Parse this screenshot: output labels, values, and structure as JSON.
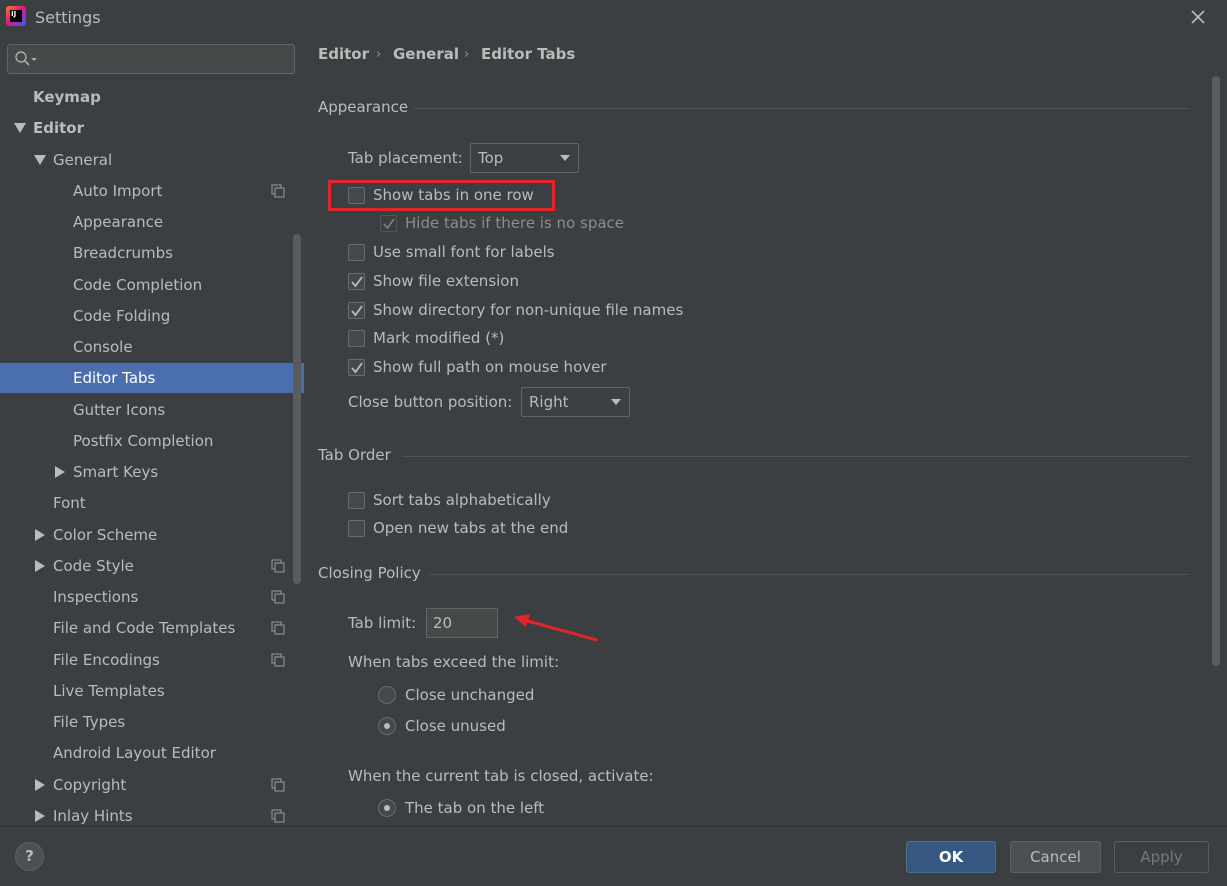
{
  "window": {
    "title": "Settings"
  },
  "search": {
    "placeholder": ""
  },
  "sidebar": {
    "items": [
      {
        "label": "Keymap"
      },
      {
        "label": "Editor"
      },
      {
        "label": "General"
      },
      {
        "label": "Auto Import"
      },
      {
        "label": "Appearance"
      },
      {
        "label": "Breadcrumbs"
      },
      {
        "label": "Code Completion"
      },
      {
        "label": "Code Folding"
      },
      {
        "label": "Console"
      },
      {
        "label": "Editor Tabs"
      },
      {
        "label": "Gutter Icons"
      },
      {
        "label": "Postfix Completion"
      },
      {
        "label": "Smart Keys"
      },
      {
        "label": "Font"
      },
      {
        "label": "Color Scheme"
      },
      {
        "label": "Code Style"
      },
      {
        "label": "Inspections"
      },
      {
        "label": "File and Code Templates"
      },
      {
        "label": "File Encodings"
      },
      {
        "label": "Live Templates"
      },
      {
        "label": "File Types"
      },
      {
        "label": "Android Layout Editor"
      },
      {
        "label": "Copyright"
      },
      {
        "label": "Inlay Hints"
      }
    ]
  },
  "breadcrumb": [
    "Editor",
    "General",
    "Editor Tabs"
  ],
  "appearance": {
    "title": "Appearance",
    "tab_placement_label": "Tab placement:",
    "tab_placement_value": "Top",
    "show_tabs_one_row": "Show tabs in one row",
    "hide_tabs_no_space": "Hide tabs if there is no space",
    "small_font": "Use small font for labels",
    "show_extension": "Show file extension",
    "show_directory": "Show directory for non-unique file names",
    "mark_modified": "Mark modified (*)",
    "full_path_hover": "Show full path on mouse hover",
    "close_button_label": "Close button position:",
    "close_button_value": "Right"
  },
  "tab_order": {
    "title": "Tab Order",
    "sort_alpha": "Sort tabs alphabetically",
    "open_at_end": "Open new tabs at the end"
  },
  "closing_policy": {
    "title": "Closing Policy",
    "tab_limit_label": "Tab limit:",
    "tab_limit_value": "20",
    "exceed_label": "When tabs exceed the limit:",
    "close_unchanged": "Close unchanged",
    "close_unused": "Close unused",
    "activate_label": "When the current tab is closed, activate:",
    "tab_on_left": "The tab on the left"
  },
  "footer": {
    "help": "?",
    "ok": "OK",
    "cancel": "Cancel",
    "apply": "Apply"
  },
  "colors": {
    "selection": "#4b6eaf",
    "highlight": "#e3242b",
    "ok_button": "#365880"
  }
}
